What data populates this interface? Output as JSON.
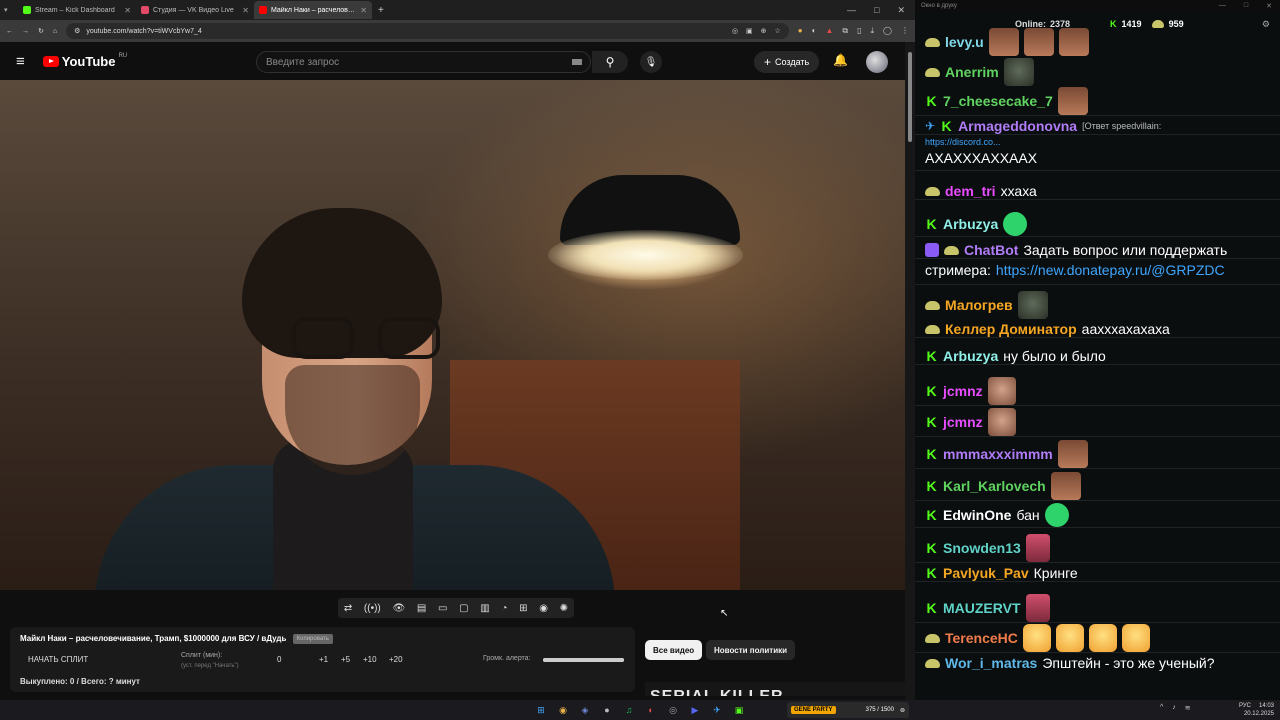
{
  "browser": {
    "tabs": [
      {
        "title": "Stream – Kick Dashboard",
        "color": "#53fc18",
        "active": false
      },
      {
        "title": "Студия — VK Видео Live",
        "color": "#e24a67",
        "active": false
      },
      {
        "title": "Майкл Наки – расчеловечива",
        "color": "#ff0000",
        "active": true
      }
    ],
    "new_tab": "+",
    "url": "youtube.com/watch?v=tiWVcbYw7_4"
  },
  "youtube": {
    "logo": "YouTube",
    "region": "RU",
    "search_placeholder": "Введите запрос",
    "create_label": "Создать"
  },
  "video_controls": [
    "⇄",
    "((•))",
    "👁",
    "▤",
    "▭",
    "▢",
    "▥",
    "◔",
    "⊞",
    "◉",
    "✺"
  ],
  "widget": {
    "title": "Майкл Наки – расчеловечивание, Трамп, $1000000 для ВСУ / вДудь",
    "copy_label": "Копировать",
    "start_label": "НАЧАТЬ СПЛИТ",
    "split_label": "Сплит (мин):",
    "split_hint": "(уст. перед \"Начать\")",
    "split_value": "0",
    "steps": [
      "+1",
      "+5",
      "+10",
      "+20"
    ],
    "volume_label": "Громк. алерта:",
    "volume_level": 1.0,
    "bought": "Выкуплено: 0 / Всего: ? минут"
  },
  "filters": {
    "all": "Все видео",
    "politics": "Новости политики"
  },
  "thumb_text": "SERIAL KILLER",
  "chat": {
    "window_title": "Окно в друку",
    "online_label": "Online:",
    "online_value": "2378",
    "kick_count": "1419",
    "second_count": "959",
    "messages": [
      {
        "badges": [
          "s"
        ],
        "nick": "levy.u",
        "color": "#7fd8e8",
        "text": "",
        "emotes": [
          "face",
          "face",
          "face"
        ]
      },
      {
        "badges": [
          "s"
        ],
        "nick": "Anerrim",
        "color": "#5fd35f",
        "text": "",
        "emotes": [
          "rock"
        ]
      },
      {
        "badges": [
          "k"
        ],
        "nick": "7_cheesecake_7",
        "color": "#5fd35f",
        "text": "",
        "emotes": [
          "face"
        ]
      },
      {
        "badges": [
          "p",
          "k"
        ],
        "nick": "Armageddonovna",
        "color": "#b07cf7",
        "reply": "[Ответ speedvillain:",
        "reply_link": "https://discord.co...",
        "text": "АХАХХХАХХААХ"
      },
      {
        "badges": [
          "s"
        ],
        "nick": "dem_tri",
        "color": "#e84dff",
        "text": "ххаха"
      },
      {
        "badges": [
          "k"
        ],
        "nick": "Arbuzya",
        "color": "#8ff0e8",
        "text": "",
        "emotes": [
          "green"
        ]
      },
      {
        "badges": [
          "b",
          "s"
        ],
        "nick": "ChatBot",
        "color": "#b07cf7",
        "text": "Задать вопрос или поддержать",
        "line2": "стримера: ",
        "link": "https://new.donatepay.ru/@GRPZDC"
      },
      {
        "badges": [
          "s"
        ],
        "nick": "Малогрев",
        "color": "#f5a623",
        "text": "",
        "emotes": [
          "rock"
        ]
      },
      {
        "badges": [
          "s"
        ],
        "nick": "Келлер Доминатор",
        "color": "#f5a623",
        "text": "аахххахахаха"
      },
      {
        "badges": [
          "k"
        ],
        "nick": "Arbuzya",
        "color": "#8ff0e8",
        "text": "ну было и было"
      },
      {
        "badges": [
          "k"
        ],
        "nick": "jcmnz",
        "color": "#e84dff",
        "text": "",
        "emotes": [
          "man"
        ]
      },
      {
        "badges": [
          "k"
        ],
        "nick": "jcmnz",
        "color": "#e84dff",
        "text": "",
        "emotes": [
          "man"
        ]
      },
      {
        "badges": [
          "k"
        ],
        "nick": "mmmaxxximmm",
        "color": "#b07cf7",
        "text": "",
        "emotes": [
          "face"
        ]
      },
      {
        "badges": [
          "k"
        ],
        "nick": "Karl_Karlovech",
        "color": "#5fd35f",
        "text": "",
        "emotes": [
          "face"
        ]
      },
      {
        "badges": [
          "k"
        ],
        "nick": "EdwinOne",
        "color": "#ffffff",
        "text": "бан",
        "emotes": [
          "green"
        ]
      },
      {
        "badges": [
          "k"
        ],
        "nick": "Snowden13",
        "color": "#5fd3c8",
        "text": "",
        "emotes": [
          "cat"
        ]
      },
      {
        "badges": [
          "k"
        ],
        "nick": "Pavlyuk_Pav",
        "color": "#f5a623",
        "text": "Кринге"
      },
      {
        "badges": [
          "k"
        ],
        "nick": "MAUZERVT",
        "color": "#5fd3c8",
        "text": "",
        "emotes": [
          "cat"
        ]
      },
      {
        "badges": [
          "s"
        ],
        "nick": "TerenceHC",
        "color": "#f07c4a",
        "text": "",
        "emotes": [
          "laugh",
          "laugh",
          "laugh",
          "laugh"
        ]
      },
      {
        "badges": [
          "s"
        ],
        "nick": "Wor_i_matras",
        "color": "#5fb8e8",
        "text": "Эпштейн - это же ученый?"
      }
    ]
  },
  "taskbar": {
    "game_label": "GENE PARTY",
    "game_progress": "375 / 1500",
    "lang": "РУС",
    "time": "14:03",
    "date": "20.12.2025"
  }
}
